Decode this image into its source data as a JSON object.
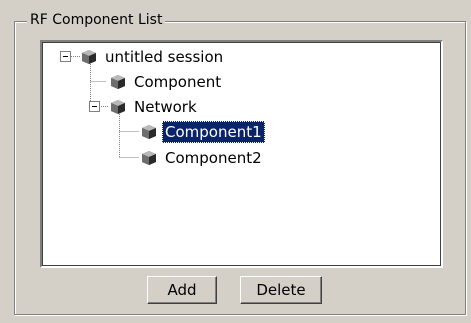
{
  "group": {
    "title": "RF Component List"
  },
  "tree": {
    "nodes": [
      {
        "label": "untitled session",
        "expanded": true
      },
      {
        "label": "Component"
      },
      {
        "label": "Network",
        "expanded": true
      },
      {
        "label": "Component1",
        "selected": true
      },
      {
        "label": "Component2"
      }
    ]
  },
  "buttons": {
    "add_label": "Add",
    "delete_label": "Delete"
  },
  "icons": {
    "node": "cube-icon",
    "expand": "minus-box-icon"
  },
  "colors": {
    "selection": "#0a246a",
    "background": "#d4d0c8"
  }
}
